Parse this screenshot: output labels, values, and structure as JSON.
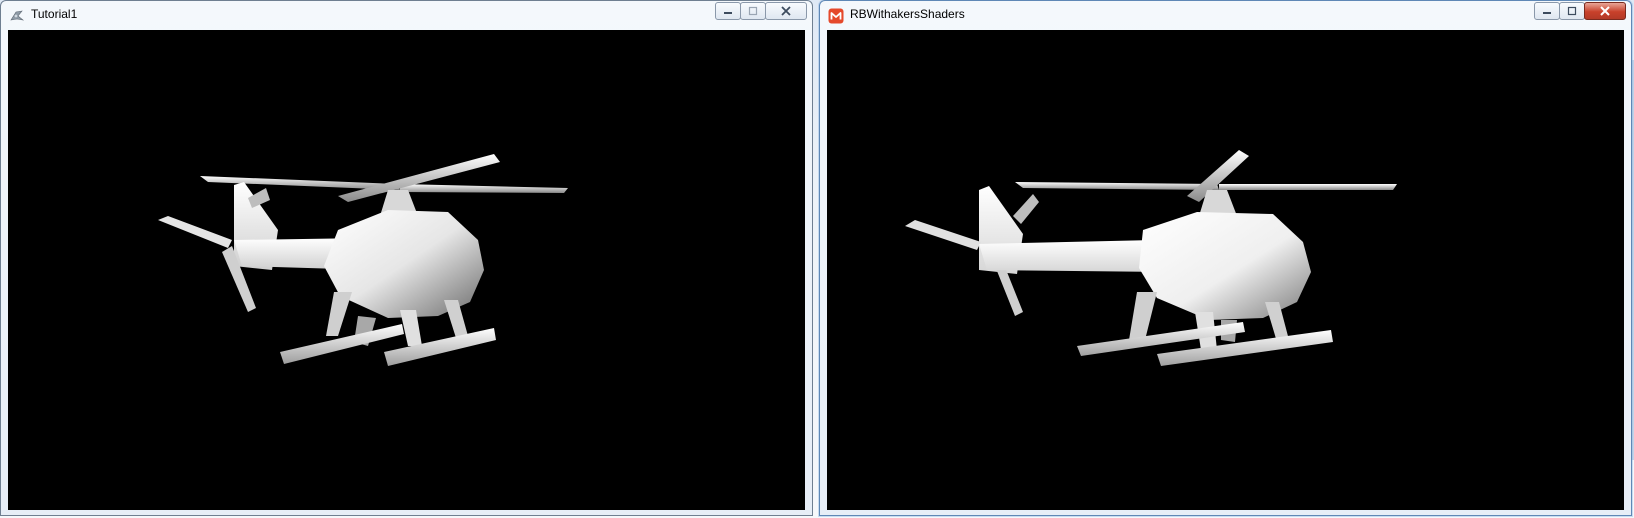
{
  "windows": [
    {
      "title": "Tutorial1",
      "icon": "xna-icon",
      "controls": [
        "minimize",
        "maximize",
        "close"
      ]
    },
    {
      "title": "RBWithakersShaders",
      "icon": "monogame-icon",
      "controls": [
        "minimize",
        "maximize",
        "close"
      ]
    }
  ],
  "colors": {
    "viewport_background": "#000000",
    "model_color": "#ffffff",
    "monogame_icon": "#e5492b"
  }
}
